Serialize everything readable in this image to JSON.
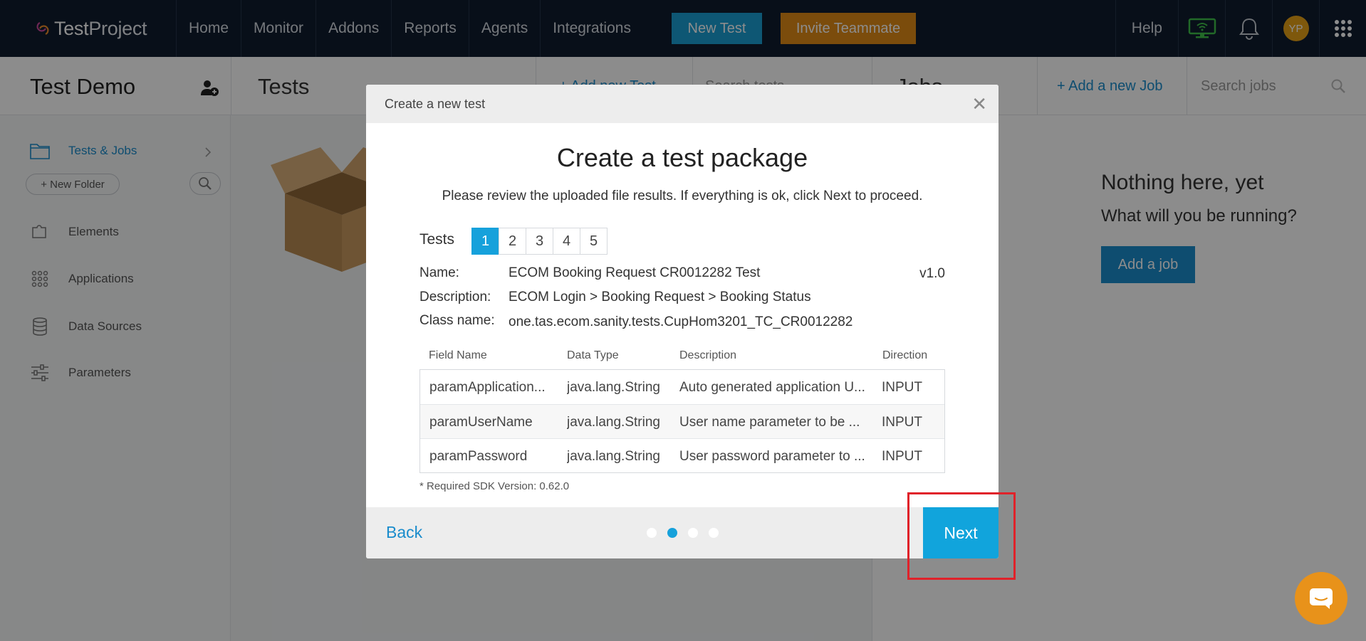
{
  "navbar": {
    "logo": {
      "brand_strong": "Test",
      "brand_light": "Project"
    },
    "items": [
      "Home",
      "Monitor",
      "Addons",
      "Reports",
      "Agents",
      "Integrations"
    ],
    "new_test": "New Test",
    "invite": "Invite Teammate",
    "help": "Help",
    "avatar_initials": "YP"
  },
  "subheader": {
    "project": "Test Demo",
    "tests_title": "Tests",
    "tests_links": "+ Add new Test",
    "search_tests": "Search tests",
    "jobs_title": "Jobs",
    "add_job": "+  Add a new Job",
    "search_jobs": "Search jobs"
  },
  "sidebar": {
    "tests_jobs": "Tests & Jobs",
    "new_folder": "+ New Folder",
    "items": [
      "Elements",
      "Applications",
      "Data Sources",
      "Parameters"
    ]
  },
  "jobs_panel": {
    "empty_title": "Nothing here, yet",
    "empty_sub": "What will you be running?",
    "add_job_btn": "Add a job"
  },
  "modal": {
    "header": "Create a new test",
    "title": "Create a test package",
    "description": "Please review the uploaded file results. If everything is ok, click Next to proceed.",
    "tests_label": "Tests",
    "tabs": [
      "1",
      "2",
      "3",
      "4",
      "5"
    ],
    "active_tab": "1",
    "name_label": "Name:",
    "name_value": "ECOM Booking Request CR0012282 Test",
    "version": "v1.0",
    "description_label": "Description:",
    "description_value": "ECOM Login > Booking Request > Booking Status",
    "class_label": "Class name:",
    "class_value": "one.tas.ecom.sanity.tests.CupHom3201_TC_CR0012282",
    "columns": [
      "Field Name",
      "Data Type",
      "Description",
      "Direction"
    ],
    "rows": [
      [
        "paramApplication...",
        "java.lang.String",
        "Auto generated application U...",
        "INPUT"
      ],
      [
        "paramUserName",
        "java.lang.String",
        "User name parameter to be ...",
        "INPUT"
      ],
      [
        "paramPassword",
        "java.lang.String",
        "User password parameter to ...",
        "INPUT"
      ]
    ],
    "sdk_note": "* Required SDK Version: 0.62.0",
    "back": "Back",
    "next": "Next",
    "steps_total": 4,
    "step_active": 2
  },
  "colors": {
    "navbar_bg": "#0f1c2e",
    "primary": "#16a1db",
    "invite": "#e18b16",
    "highlight": "#e0222a"
  }
}
